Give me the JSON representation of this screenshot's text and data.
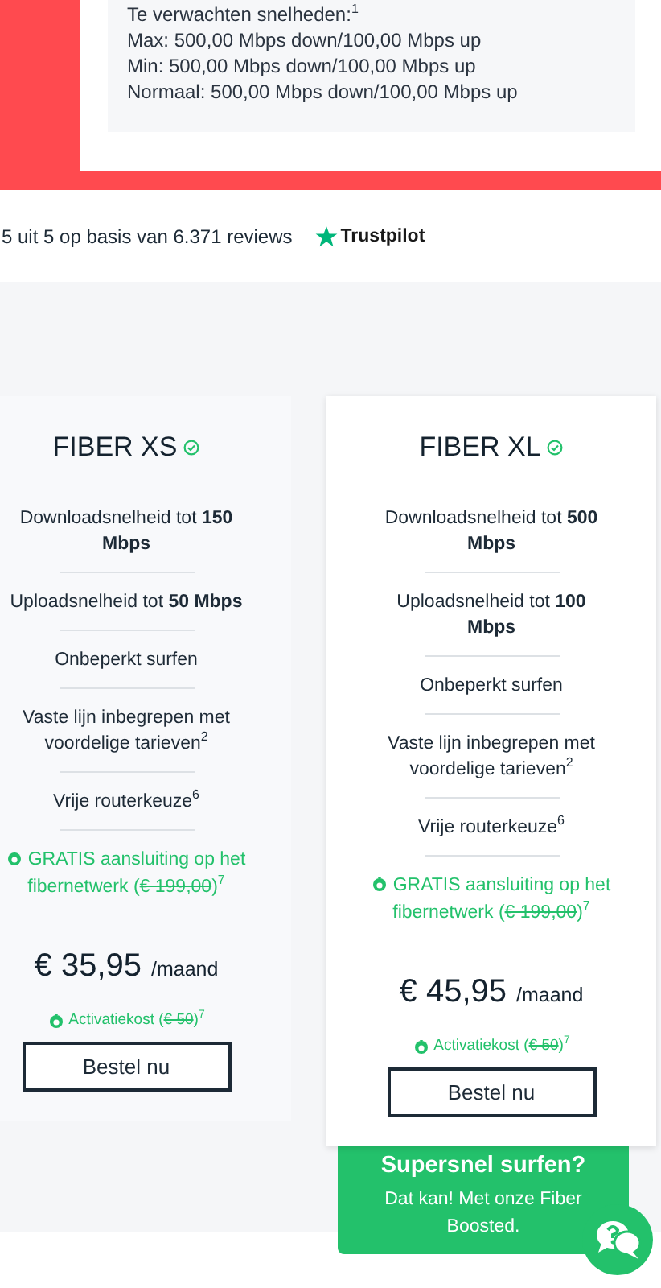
{
  "speed_info": {
    "heading": "Te verwachten snelheden:$^{1}$",
    "lines": [
      "Max: 500,00 Mbps down/100,00 Mbps up",
      "Min: 500,00 Mbps down/100,00 Mbps up",
      "Normaal: 500,00 Mbps down/100,00 Mbps up"
    ]
  },
  "reviews": {
    "text": "5 uit 5 op basis van 6.371 reviews",
    "brand": "Trustpilot"
  },
  "plans": [
    {
      "name": "FIBER XS",
      "highlighted": false,
      "features": [
        "Downloadsnelheid tot **150 Mbps**",
        "Uploadsnelheid tot **50 Mbps**",
        "Onbeperkt surfen",
        "Vaste lijn inbegrepen met voordelige tarieven$^{2}$",
        "Vrije routerkeuze$^{6}$"
      ],
      "promo": {
        "text": "GRATIS aansluiting op het fibernetwerk (",
        "old_price": "€ 199,00",
        "close": ")",
        "note": "7"
      },
      "price": "€ 35,95",
      "period": "/maand",
      "fee": {
        "text": "Activatiekost (",
        "old_price": "€ 50",
        "close": ")",
        "note": "7"
      },
      "button": "Bestel nu"
    },
    {
      "name": "FIBER XL",
      "highlighted": true,
      "features": [
        "Downloadsnelheid tot **500 Mbps**",
        "Uploadsnelheid tot **100 Mbps**",
        "Onbeperkt surfen",
        "Vaste lijn inbegrepen met voordelige tarieven$^{2}$",
        "Vrije routerkeuze$^{6}$"
      ],
      "promo": {
        "text": "GRATIS aansluiting op het fibernetwerk (",
        "old_price": "€ 199,00",
        "close": ")",
        "note": "7"
      },
      "price": "€ 45,95",
      "period": "/maand",
      "fee": {
        "text": "Activatiekost (",
        "old_price": "€ 50",
        "close": ")",
        "note": "7"
      },
      "button": "Bestel nu"
    }
  ],
  "banner": {
    "title": "Supersnel surfen?",
    "text": "Dat kan! Met onze Fiber Boosted."
  }
}
